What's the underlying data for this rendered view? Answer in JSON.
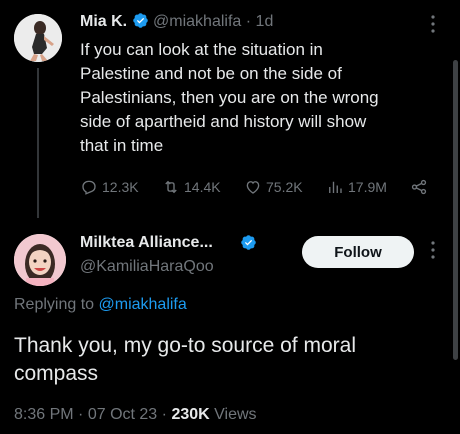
{
  "colors": {
    "accent": "#1d9bf0",
    "background": "#000000",
    "muted": "#71767b",
    "text": "#e7e9ea"
  },
  "first_tweet": {
    "display_name": "Mia K.",
    "handle": "@miakhalifa",
    "separator": "·",
    "age": "1d",
    "text_lines": [
      "If you can look at the situation in",
      "Palestine and not be on the side of",
      "Palestinians, then you are on the wrong",
      "side of apartheid and history will show",
      "that in time"
    ],
    "actions": {
      "replies": "12.3K",
      "retweets": "14.4K",
      "likes": "75.2K",
      "views": "17.9M"
    },
    "icons": [
      "verified-badge-icon",
      "more-icon",
      "reply-icon",
      "retweet-icon",
      "like-icon",
      "views-icon",
      "share-icon"
    ]
  },
  "reply_tweet": {
    "display_name": "Milktea Alliance...",
    "handle": "@KamiliaHaraQoo",
    "follow_label": "Follow",
    "replying_prefix": "Replying to",
    "replying_handle": "@miakhalifa",
    "text_lines": [
      "Thank you, my go-to source of moral",
      "compass"
    ],
    "time": "8:36 PM",
    "separator": "·",
    "date": "07 Oct 23",
    "views_count": "230K",
    "views_label": "Views"
  }
}
